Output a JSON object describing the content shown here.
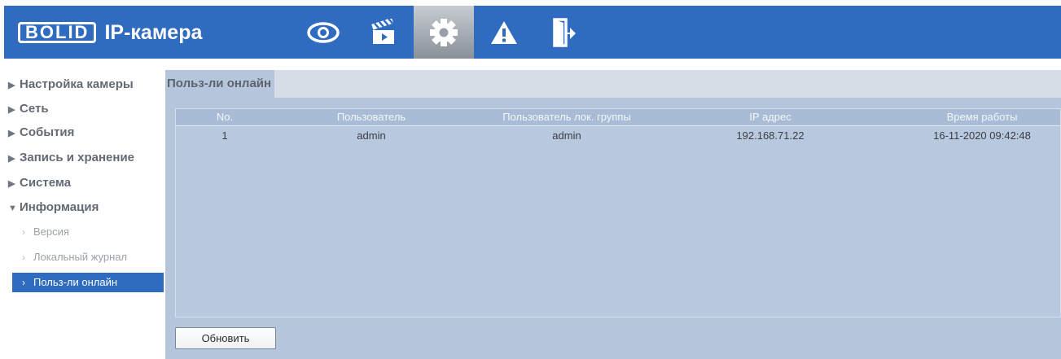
{
  "header": {
    "logo_mark": "BOLID",
    "logo_text": "IP-камера",
    "nav_tabs": [
      {
        "icon": "eye-icon"
      },
      {
        "icon": "clapperboard-icon"
      },
      {
        "icon": "gear-icon",
        "active": true
      },
      {
        "icon": "warning-icon"
      },
      {
        "icon": "logout-icon"
      }
    ],
    "accent_color": "#2f6cc0"
  },
  "sidebar": {
    "menu": [
      {
        "label": "Настройка камеры",
        "state": "collapsed"
      },
      {
        "label": "Сеть",
        "state": "collapsed"
      },
      {
        "label": "События",
        "state": "collapsed"
      },
      {
        "label": "Запись и хранение",
        "state": "collapsed"
      },
      {
        "label": "Система",
        "state": "collapsed"
      },
      {
        "label": "Информация",
        "state": "expanded"
      }
    ],
    "submenu": [
      {
        "label": "Версия"
      },
      {
        "label": "Локальный журнал"
      },
      {
        "label": "Польз-ли онлайн",
        "active": true
      }
    ]
  },
  "content": {
    "tab_label": "Польз-ли онлайн",
    "table": {
      "columns": [
        "No.",
        "Пользователь",
        "Пользователь лок. группы",
        "IP адрес",
        "Время работы"
      ],
      "rows": [
        [
          "1",
          "admin",
          "admin",
          "192.168.71.22",
          "16-11-2020 09:42:48"
        ]
      ]
    },
    "refresh_button": "Обновить"
  }
}
